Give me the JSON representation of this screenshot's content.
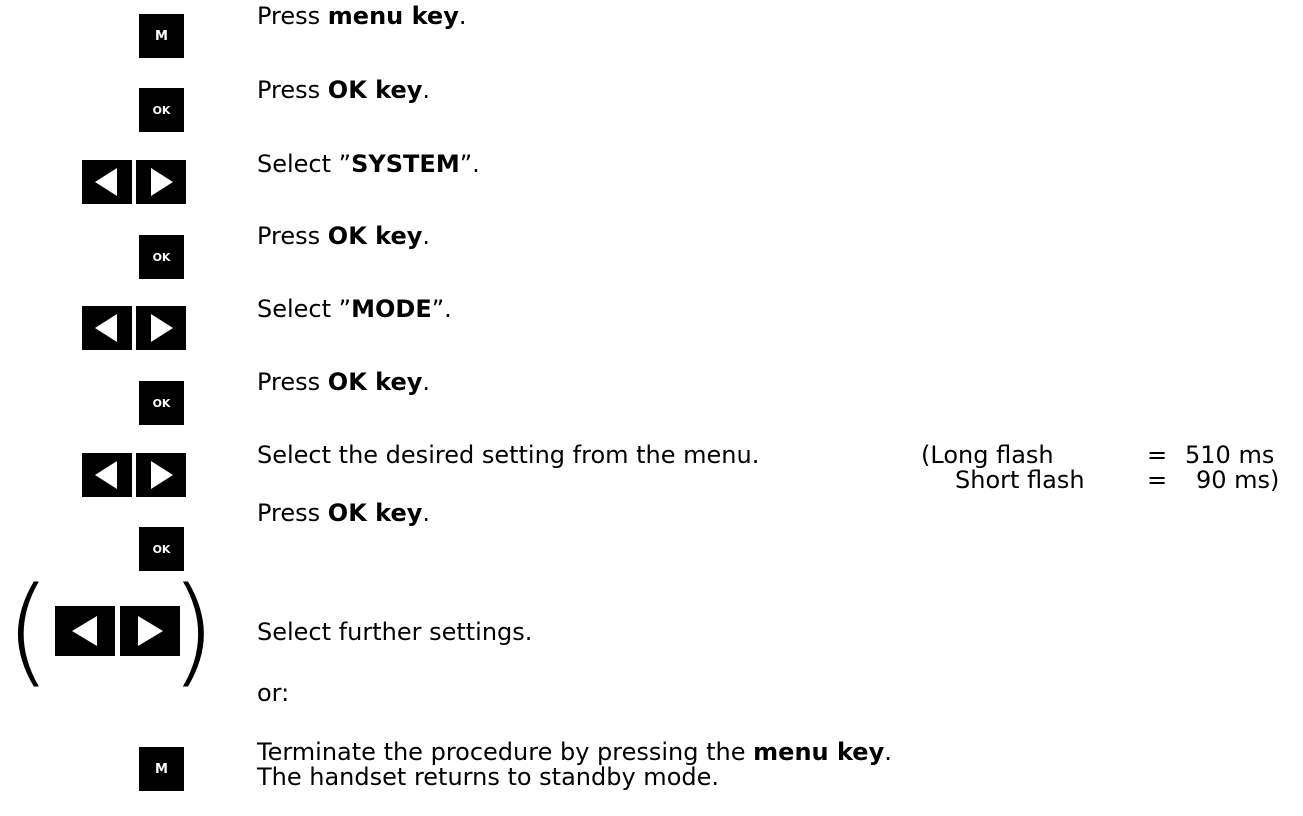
{
  "steps": [
    {
      "key": "M",
      "parts": [
        "Press ",
        "menu key",
        "."
      ]
    },
    {
      "key": "OK",
      "parts": [
        "Press ",
        "OK key",
        "."
      ]
    },
    {
      "key": "arrows",
      "parts": [
        "Select ”",
        "SYSTEM",
        "”."
      ]
    },
    {
      "key": "OK",
      "parts": [
        "Press ",
        "OK key",
        "."
      ]
    },
    {
      "key": "arrows",
      "parts": [
        "Select ”",
        "MODE",
        "”."
      ]
    },
    {
      "key": "OK",
      "parts": [
        "Press ",
        "OK key",
        "."
      ]
    },
    {
      "key": "arrows",
      "parts": [
        "Select the desired setting from the menu.",
        "",
        ""
      ]
    },
    {
      "key": "OK",
      "parts": [
        "Press ",
        "OK key",
        "."
      ]
    }
  ],
  "flash_note": {
    "long_label": "(Long flash",
    "long_eq": "=",
    "long_value": "510 ms",
    "short_label": "Short flash",
    "short_eq": "=",
    "short_value": "90 ms)"
  },
  "optional": {
    "text": "Select further settings.",
    "or": "or:"
  },
  "terminate": {
    "key": "M",
    "line1_pre": "Terminate the procedure by pressing the ",
    "line1_bold": "menu key",
    "line1_post": ".",
    "line2": "The handset returns to standby mode."
  },
  "icons": {
    "left_arrow": "left-triangle-icon",
    "right_arrow": "right-triangle-icon"
  }
}
